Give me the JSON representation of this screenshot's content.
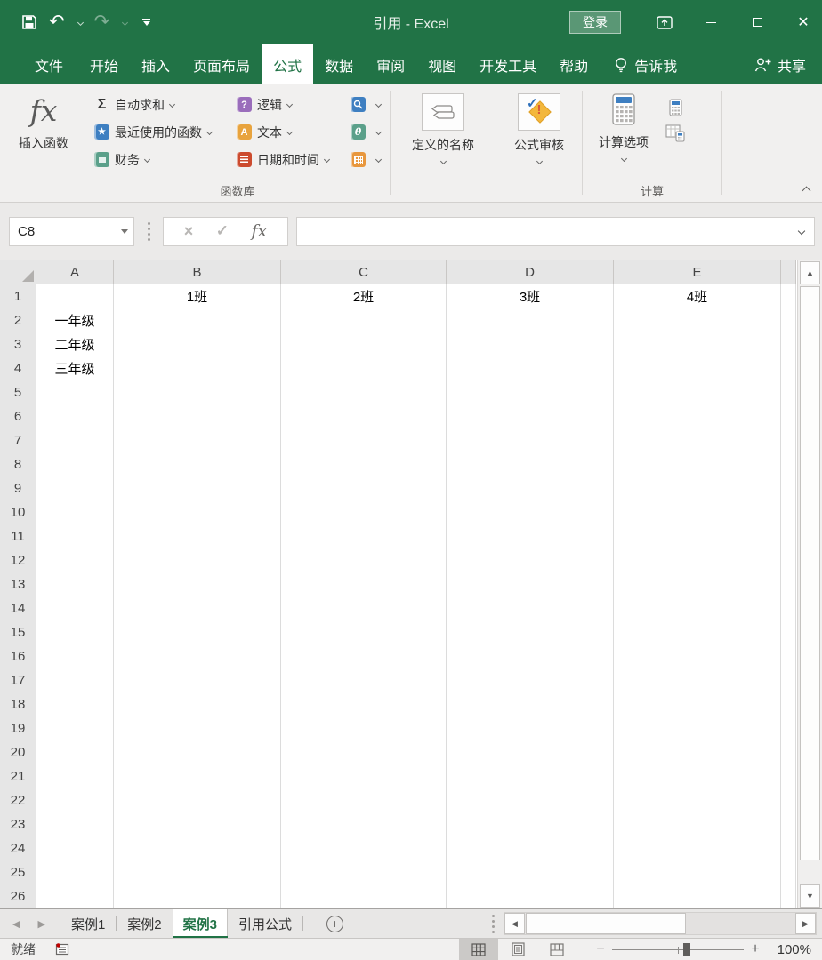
{
  "window": {
    "title": "引用 - Excel",
    "sign_in": "登录"
  },
  "tabs": [
    {
      "label": "文件",
      "active": false
    },
    {
      "label": "开始",
      "active": false
    },
    {
      "label": "插入",
      "active": false
    },
    {
      "label": "页面布局",
      "active": false
    },
    {
      "label": "公式",
      "active": true
    },
    {
      "label": "数据",
      "active": false
    },
    {
      "label": "审阅",
      "active": false
    },
    {
      "label": "视图",
      "active": false
    },
    {
      "label": "开发工具",
      "active": false
    },
    {
      "label": "帮助",
      "active": false
    },
    {
      "label": "告诉我",
      "active": false
    },
    {
      "label": "共享",
      "active": false
    }
  ],
  "ribbon": {
    "insert_function": {
      "glyph": "fx",
      "label": "插入函数"
    },
    "library": {
      "group_label": "函数库",
      "autosum": {
        "glyph": "Σ",
        "label": "自动求和"
      },
      "recent": {
        "glyph": "★",
        "label": "最近使用的函数"
      },
      "financial": {
        "glyph": "",
        "label": "财务"
      },
      "logical": {
        "glyph": "?",
        "label": "逻辑"
      },
      "text": {
        "glyph": "A",
        "label": "文本"
      },
      "datetime": {
        "label": "日期和时间"
      },
      "math_glyph": "θ"
    },
    "defined_names_label": "定义的名称",
    "auditing_label": "公式审核",
    "calc": {
      "group_label": "计算",
      "options_label": "计算选项"
    }
  },
  "formula_bar": {
    "name_box": "C8",
    "value": "",
    "cancel_glyph": "×",
    "enter_glyph": "✓",
    "fx_glyph": "fx"
  },
  "grid": {
    "columns": [
      "A",
      "B",
      "C",
      "D",
      "E"
    ],
    "row_count": 26,
    "cells": {
      "B1": "1班",
      "C1": "2班",
      "D1": "3班",
      "E1": "4班",
      "A2": "一年级",
      "A3": "二年级",
      "A4": "三年级"
    }
  },
  "sheet_bar": {
    "tabs": [
      {
        "label": "案例1",
        "active": false
      },
      {
        "label": "案例2",
        "active": false
      },
      {
        "label": "案例3",
        "active": true
      },
      {
        "label": "引用公式",
        "active": false
      }
    ],
    "add_label": "+"
  },
  "status_bar": {
    "mode": "就绪",
    "zoom_level": "100%"
  }
}
